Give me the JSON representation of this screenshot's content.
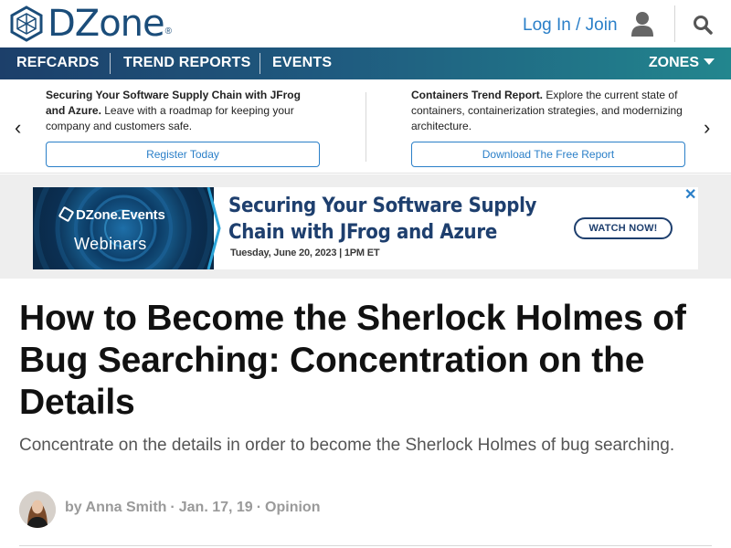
{
  "header": {
    "logo_text": "DZone",
    "logo_reg": "®",
    "login_label": "Log In / Join",
    "icons": [
      "dzone-logo-icon",
      "user-icon",
      "search-icon"
    ]
  },
  "nav": {
    "items": [
      "REFCARDS",
      "TREND REPORTS",
      "EVENTS"
    ],
    "zones_label": "ZONES"
  },
  "promo": {
    "left": {
      "title": "Securing Your Software Supply Chain with JFrog and Azure.",
      "body": " Leave with a roadmap for keeping your company and customers safe.",
      "button": "Register Today"
    },
    "right": {
      "title": "Containers Trend Report.",
      "body": " Explore the current state of containers, containerization strategies, and modernizing architecture.",
      "button": "Download The Free Report"
    },
    "prev_arrow": "‹",
    "next_arrow": "›"
  },
  "ad": {
    "brand": "DZone.Events",
    "category": "Webinars",
    "title": "Securing Your Software Supply Chain with JFrog and Azure",
    "date": "Tuesday, June 20, 2023 | 1PM ET",
    "cta": "WATCH NOW!",
    "close": "✕"
  },
  "article": {
    "title": "How to Become the Sherlock Holmes of Bug Searching: Concentration on the Details",
    "subtitle": "Concentrate on the details in order to become the Sherlock Holmes of bug searching.",
    "author": "by Anna Smith",
    "date": "Jan. 17, 19",
    "category": "Opinion",
    "separator": "·"
  },
  "colors": {
    "brand_blue": "#1b4d7a",
    "link_blue": "#2a7fc8",
    "nav_gradient_start": "#1c3f6a",
    "nav_gradient_end": "#22868e"
  }
}
